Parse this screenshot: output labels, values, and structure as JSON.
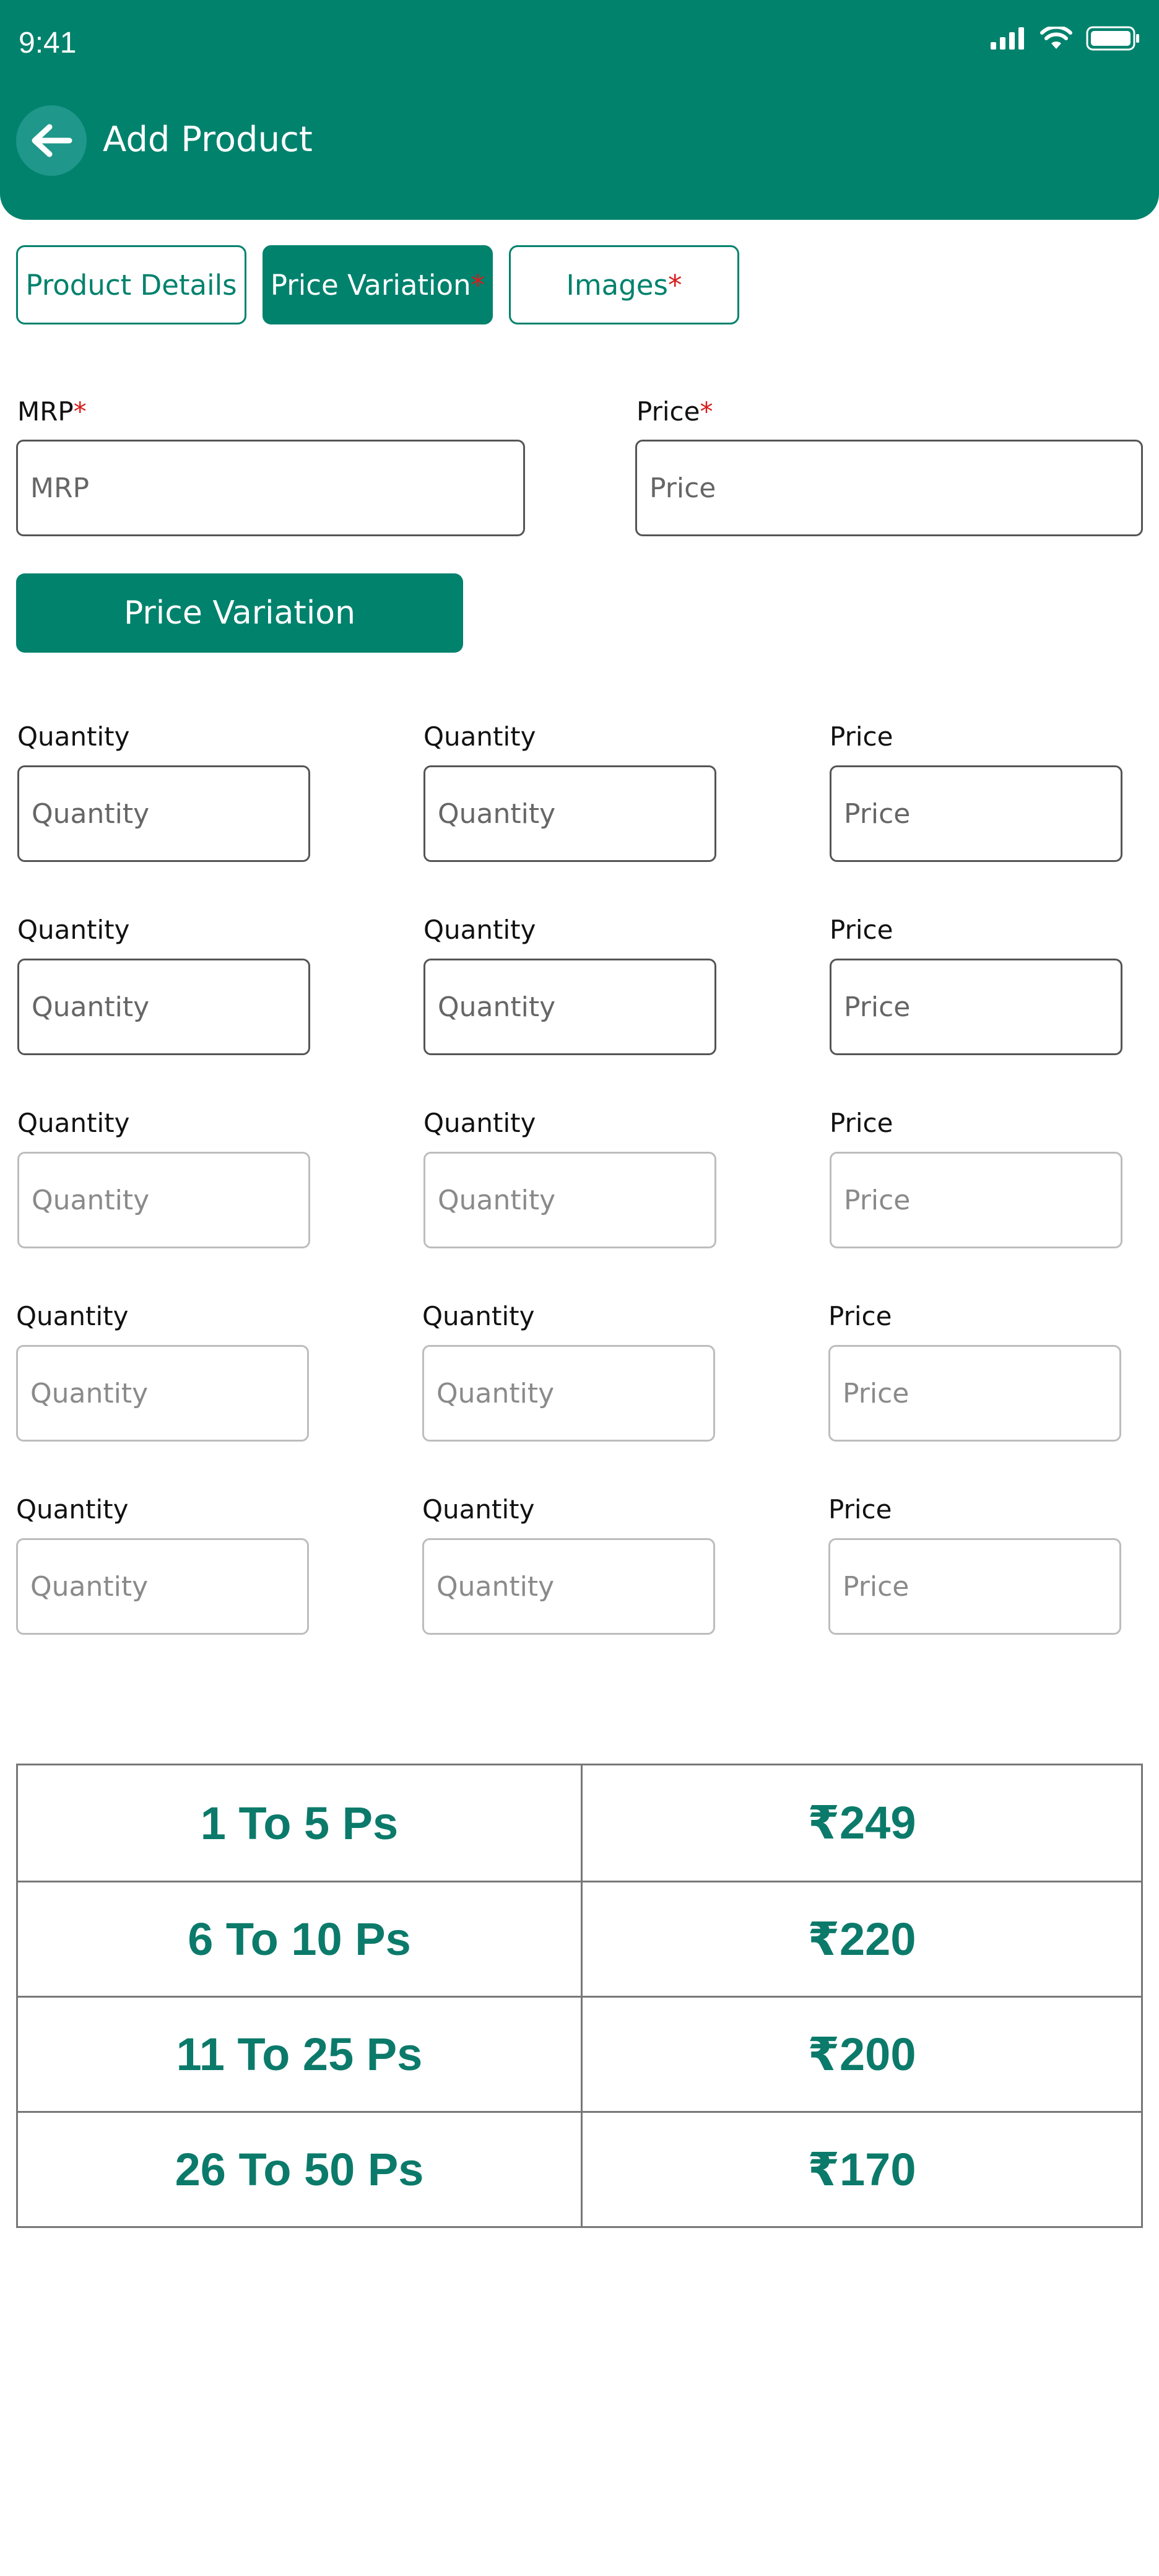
{
  "status_bar": {
    "time": "9:41"
  },
  "header": {
    "title": "Add Product"
  },
  "tabs": [
    {
      "label": "Product Details",
      "required": ""
    },
    {
      "label": "Price Variation",
      "required": "*"
    },
    {
      "label": "Images",
      "required": "*"
    }
  ],
  "form": {
    "mrp": {
      "label": "MRP",
      "required": "*",
      "placeholder": "MRP",
      "value": ""
    },
    "price": {
      "label": "Price",
      "required": "*",
      "placeholder": "Price",
      "value": ""
    }
  },
  "price_variation_button": "Price Variation",
  "variation_rows": [
    {
      "qty_from_label": "Quantity",
      "qty_from_placeholder": "Quantity",
      "qty_to_label": "Quantity",
      "qty_to_placeholder": "Quantity",
      "price_label": "Price",
      "price_placeholder": "Price"
    },
    {
      "qty_from_label": "Quantity",
      "qty_from_placeholder": "Quantity",
      "qty_to_label": "Quantity",
      "qty_to_placeholder": "Quantity",
      "price_label": "Price",
      "price_placeholder": "Price"
    },
    {
      "qty_from_label": "Quantity",
      "qty_from_placeholder": "Quantity",
      "qty_to_label": "Quantity",
      "qty_to_placeholder": "Quantity",
      "price_label": "Price",
      "price_placeholder": "Price"
    },
    {
      "qty_from_label": "Quantity",
      "qty_from_placeholder": "Quantity",
      "qty_to_label": "Quantity",
      "qty_to_placeholder": "Quantity",
      "price_label": "Price",
      "price_placeholder": "Price"
    },
    {
      "qty_from_label": "Quantity",
      "qty_from_placeholder": "Quantity",
      "qty_to_label": "Quantity",
      "qty_to_placeholder": "Quantity",
      "price_label": "Price",
      "price_placeholder": "Price"
    }
  ],
  "price_table": [
    {
      "range": "1 To 5 Ps",
      "price": "₹249"
    },
    {
      "range": "6 To 10 Ps",
      "price": "₹220"
    },
    {
      "range": "11 To 25 Ps",
      "price": "₹200"
    },
    {
      "range": "26 To 50 Ps",
      "price": "₹170"
    }
  ],
  "colors": {
    "brand": "#00826d",
    "required": "#d81b1b",
    "table_text": "#0b7a6a"
  },
  "icons": {
    "back": "arrow-left-icon",
    "signal": "signal-icon",
    "wifi": "wifi-icon",
    "battery": "battery-icon"
  }
}
